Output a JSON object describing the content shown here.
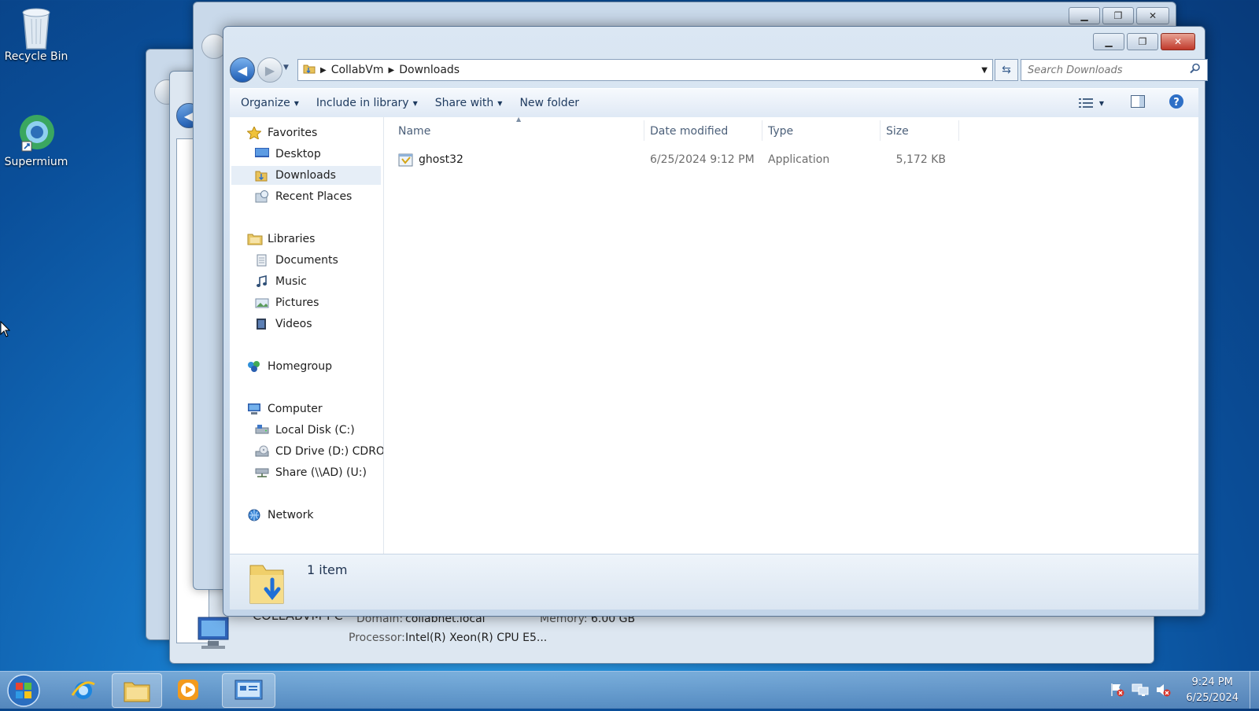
{
  "desktop": {
    "icons": [
      {
        "label": "Recycle Bin",
        "icon": "recycle-bin-icon"
      },
      {
        "label": "Supermium",
        "icon": "supermium-icon"
      }
    ]
  },
  "background_window": {
    "computer_name": "COLLABVM-PC",
    "domain_label": "Domain:",
    "domain_value": "collabnet.local",
    "memory_label": "Memory:",
    "memory_value": "6.00 GB",
    "processor_label": "Processor:",
    "processor_value": "Intel(R) Xeon(R) CPU E5..."
  },
  "explorer": {
    "breadcrumb": [
      "CollabVm",
      "Downloads"
    ],
    "search_placeholder": "Search Downloads",
    "toolbar": {
      "organize": "Organize",
      "include_in_library": "Include in library",
      "share_with": "Share with",
      "new_folder": "New folder"
    },
    "nav": {
      "favorites": "Favorites",
      "desktop": "Desktop",
      "downloads": "Downloads",
      "recent_places": "Recent Places",
      "libraries": "Libraries",
      "documents": "Documents",
      "music": "Music",
      "pictures": "Pictures",
      "videos": "Videos",
      "homegroup": "Homegroup",
      "computer": "Computer",
      "local_disk": "Local Disk (C:)",
      "cd_drive": "CD Drive (D:) CDROM",
      "share": "Share (\\\\AD) (U:)",
      "network": "Network"
    },
    "columns": {
      "name": "Name",
      "date_modified": "Date modified",
      "type": "Type",
      "size": "Size"
    },
    "files": [
      {
        "name": "ghost32",
        "date_modified": "6/25/2024 9:12 PM",
        "type": "Application",
        "size": "5,172 KB"
      }
    ],
    "status": "1 item"
  },
  "taskbar": {
    "time": "9:24 PM",
    "date": "6/25/2024"
  },
  "colors": {
    "accent": "#1677c7",
    "selection": "#e6eef7",
    "close_red": "#c0392b"
  }
}
